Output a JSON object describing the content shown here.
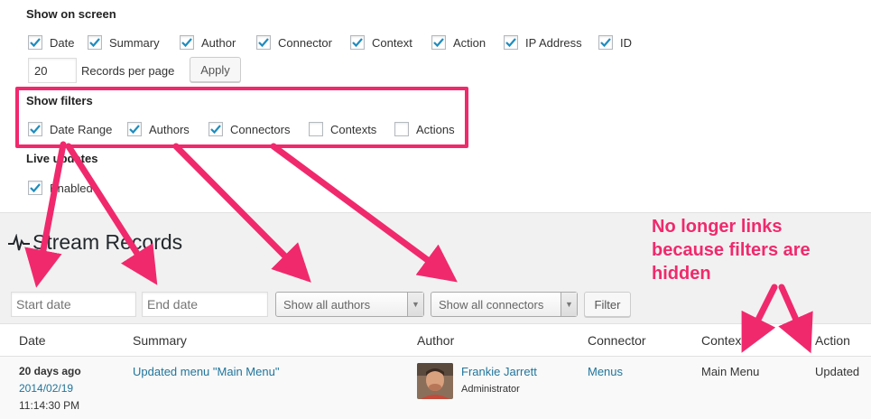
{
  "screen_options": {
    "show_on_screen_title": "Show on screen",
    "columns": [
      {
        "label": "Date",
        "checked": true
      },
      {
        "label": "Summary",
        "checked": true
      },
      {
        "label": "Author",
        "checked": true
      },
      {
        "label": "Connector",
        "checked": true
      },
      {
        "label": "Context",
        "checked": true
      },
      {
        "label": "Action",
        "checked": true
      },
      {
        "label": "IP Address",
        "checked": true
      },
      {
        "label": "ID",
        "checked": true
      }
    ],
    "records_per_page_value": "20",
    "records_per_page_label": "Records per page",
    "apply_label": "Apply",
    "show_filters_title": "Show filters",
    "filters": [
      {
        "label": "Date Range",
        "checked": true
      },
      {
        "label": "Authors",
        "checked": true
      },
      {
        "label": "Connectors",
        "checked": true
      },
      {
        "label": "Contexts",
        "checked": false
      },
      {
        "label": "Actions",
        "checked": false
      }
    ],
    "live_updates_title": "Live updates",
    "live_updates": {
      "label": "Enabled",
      "checked": true
    }
  },
  "page_title": "Stream Records",
  "filter_bar": {
    "start_date_placeholder": "Start date",
    "end_date_placeholder": "End date",
    "authors_select": "Show all authors",
    "connectors_select": "Show all connectors",
    "filter_label": "Filter"
  },
  "table": {
    "headers": [
      "Date",
      "Summary",
      "Author",
      "Connector",
      "Context",
      "Action"
    ],
    "rows": [
      {
        "date_relative": "20 days ago",
        "date": "2014/02/19",
        "time": "11:14:30 PM",
        "summary": "Updated menu \"Main Menu\"",
        "author_name": "Frankie Jarrett",
        "author_role": "Administrator",
        "connector": "Menus",
        "context": "Main Menu",
        "action": "Updated"
      }
    ]
  },
  "annotation": "No longer links because filters are hidden",
  "colors": {
    "accent": "#f0296d",
    "link": "#21759b",
    "checkmark": "#1e8cbe"
  }
}
